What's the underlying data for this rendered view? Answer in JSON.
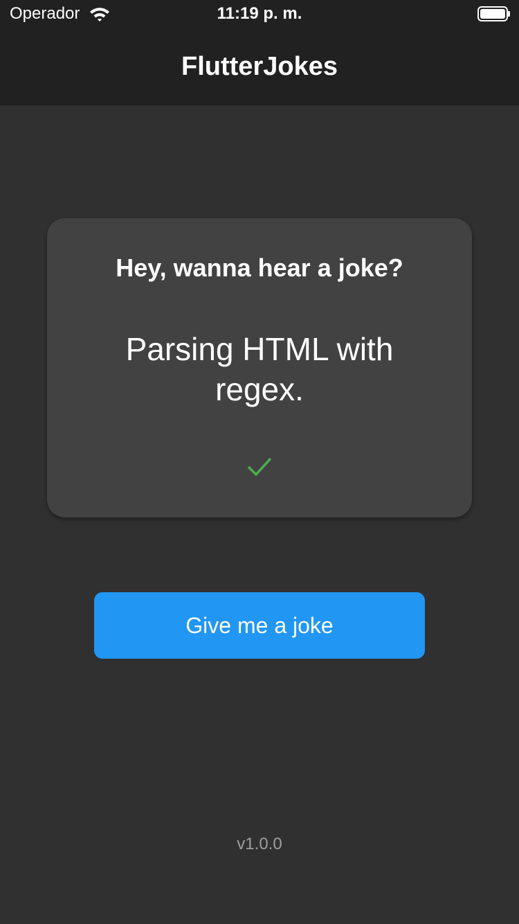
{
  "status_bar": {
    "carrier": "Operador",
    "time": "11:19 p. m.",
    "wifi_icon": "wifi-icon",
    "battery_icon": "battery-full-icon"
  },
  "app_bar": {
    "title": "FlutterJokes"
  },
  "card": {
    "heading": "Hey, wanna hear a joke?",
    "joke": "Parsing HTML with regex.",
    "status_icon": "check-icon"
  },
  "actions": {
    "joke_button_label": "Give me a joke"
  },
  "footer": {
    "version": "v1.0.0"
  },
  "colors": {
    "background": "#303030",
    "app_bar": "#212121",
    "card": "#424242",
    "button": "#2196f3",
    "check": "#4caf50",
    "version_text": "#9e9e9e"
  }
}
